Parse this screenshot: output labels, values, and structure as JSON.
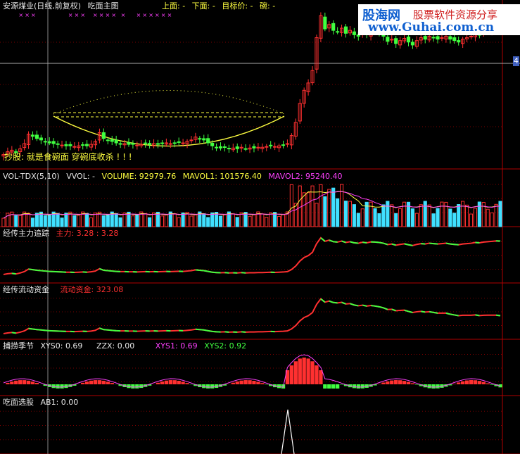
{
  "title_bar": {
    "stock": "安源煤业(日线,前复权)",
    "indicator": "吃面主图",
    "upper": "上面: -",
    "lower": "下面: -",
    "target": "目标价: -",
    "bowl": "碗: -"
  },
  "watermark": {
    "brand": "股海网",
    "slogan": "股票软件资源分享",
    "url": "www.Guhai.com.cn"
  },
  "annotation": "抄股: 就是食碗面  穿碗底收杀 ! ! !",
  "price_label": "4",
  "panels": {
    "volume": {
      "name": "VOL-TDX(5,10)",
      "vvol": "VVOL: -",
      "volume": "VOLUME: 92979.76",
      "mavol1": "MAVOL1: 101576.40",
      "mavol2": "MAVOL2: 95240.40"
    },
    "main_force": {
      "name": "经传主力追踪",
      "value": "主力: 3.28 : 3.28"
    },
    "flow": {
      "name": "经传流动资金",
      "value": "流动资金: 323.08"
    },
    "season": {
      "name": "捕捞季节",
      "xys0": "XYS0: 0.69",
      "zzx": "ZZX: 0.00",
      "xys1": "XYS1: 0.69",
      "xys2": "XYS2: 0.92"
    },
    "select": {
      "name": "吃面选股",
      "ab1": "AB1: 0.00"
    }
  },
  "colors": {
    "up": "#ff3030",
    "down": "#40ff40",
    "cyan": "#40e0ff",
    "yellow": "#ffff40",
    "magenta": "#ff40ff",
    "grid": "#7a0000"
  },
  "chart_data": {
    "type": "candlestick",
    "note": "Price series approximated; 120 trading days.",
    "closes": [
      4.0,
      4.04,
      4.06,
      4.03,
      4.08,
      4.15,
      4.28,
      4.25,
      4.22,
      4.2,
      4.18,
      4.16,
      4.15,
      4.14,
      4.13,
      4.12,
      4.12,
      4.11,
      4.12,
      4.13,
      4.12,
      4.14,
      4.18,
      4.3,
      4.22,
      4.2,
      4.18,
      4.16,
      4.15,
      4.15,
      4.14,
      4.14,
      4.13,
      4.14,
      4.15,
      4.14,
      4.15,
      4.14,
      4.15,
      4.16,
      4.15,
      4.16,
      4.17,
      4.16,
      4.18,
      4.2,
      4.24,
      4.22,
      4.2,
      4.16,
      4.12,
      4.1,
      4.09,
      4.1,
      4.08,
      4.09,
      4.08,
      4.1,
      4.08,
      4.09,
      4.09,
      4.1,
      4.1,
      4.11,
      4.12,
      4.11,
      4.12,
      4.13,
      4.15,
      4.26,
      4.44,
      4.7,
      4.88,
      4.98,
      5.15,
      5.6,
      5.9,
      5.72,
      5.78,
      5.7,
      5.68,
      5.73,
      5.66,
      5.7,
      5.64,
      5.62,
      5.67,
      5.64,
      5.69,
      5.68,
      5.66,
      5.62,
      5.55,
      5.58,
      5.52,
      5.56,
      5.59,
      5.54,
      5.5,
      5.56,
      5.6,
      5.58,
      5.62,
      5.6,
      5.58,
      5.6,
      5.62,
      5.58,
      5.56,
      5.54,
      5.58,
      5.6,
      5.62,
      5.66,
      5.64,
      5.68,
      5.7,
      5.72,
      5.74,
      5.73
    ]
  }
}
